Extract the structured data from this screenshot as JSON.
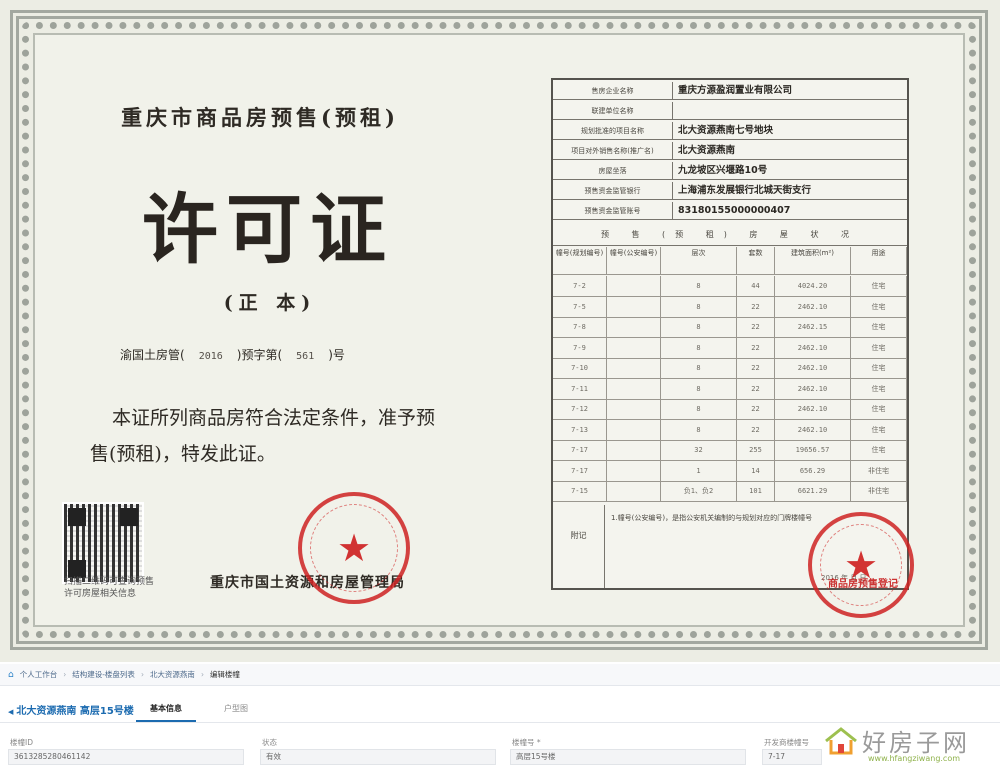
{
  "certificate": {
    "title": "重庆市商品房预售(预租)",
    "big_title": "许可证",
    "copy_type": "(正  本)",
    "number_prefix": "渝国土房管(",
    "year": "2016",
    "number_mid": ")预字第(",
    "serial": "561",
    "number_suffix": ")号",
    "statement": "本证所列商品房符合法定条件，准予预售(预租)，特发此证。",
    "qr_caption": "扫描二维码可查询预售许可房屋相关信息",
    "issuer": "重庆市国土资源和房屋管理局",
    "seal_right_label": "商品房预售登记"
  },
  "info_rows": [
    {
      "label": "售房企业名称",
      "value": "重庆方源盈润置业有限公司"
    },
    {
      "label": "联建单位名称",
      "value": ""
    },
    {
      "label": "规划批准的项目名称",
      "value": "北大资源燕南七号地块"
    },
    {
      "label": "项目对外销售名称(推广名)",
      "value": "北大资源燕南"
    },
    {
      "label": "房屋坐落",
      "value": "九龙坡区兴堰路10号"
    },
    {
      "label": "预售资金监管银行",
      "value": "上海浦东发展银行北城天街支行"
    },
    {
      "label": "预售资金监管账号",
      "value": "83180155000000407"
    }
  ],
  "status_heading": "预 售 (预 租) 房 屋 状 况",
  "grid_headers": [
    "幢号(规划编号)",
    "幢号(公安编号)",
    "层次",
    "套数",
    "建筑面积(m²)",
    "用途"
  ],
  "grid_rows": [
    [
      "7-2",
      "",
      "8",
      "44",
      "4024.20",
      "住宅"
    ],
    [
      "7-5",
      "",
      "8",
      "22",
      "2462.10",
      "住宅"
    ],
    [
      "7-8",
      "",
      "8",
      "22",
      "2462.15",
      "住宅"
    ],
    [
      "7-9",
      "",
      "8",
      "22",
      "2462.10",
      "住宅"
    ],
    [
      "7-10",
      "",
      "8",
      "22",
      "2462.10",
      "住宅"
    ],
    [
      "7-11",
      "",
      "8",
      "22",
      "2462.10",
      "住宅"
    ],
    [
      "7-12",
      "",
      "8",
      "22",
      "2462.10",
      "住宅"
    ],
    [
      "7-13",
      "",
      "8",
      "22",
      "2462.10",
      "住宅"
    ],
    [
      "7-17",
      "",
      "32",
      "255",
      "19656.57",
      "住宅"
    ],
    [
      "7-17",
      "",
      "1",
      "14",
      "656.29",
      "非住宅"
    ],
    [
      "7-15",
      "",
      "负1、负2",
      "101",
      "6621.29",
      "非住宅"
    ]
  ],
  "note": {
    "label": "附记",
    "text": "1.幢号(公安编号)，是指公安机关编制的与规划对应的门牌楼幢号",
    "date": "2016 年  月  日"
  },
  "web": {
    "breadcrumb": [
      "个人工作台",
      "结构建设-楼盘列表",
      "北大资源燕南",
      "编辑楼幢"
    ],
    "building_title": "北大资源燕南 高层15号楼",
    "tabs": [
      "基本信息",
      "户型图"
    ],
    "fields": [
      {
        "label": "楼幢ID",
        "value": "3613285280461142"
      },
      {
        "label": "状态",
        "value": "有效"
      },
      {
        "label": "楼幢号 *",
        "value": "高层15号楼"
      },
      {
        "label": "开发商楼幢号",
        "value": "7-17"
      }
    ]
  },
  "watermark": {
    "text": "好房子网",
    "url": "www.hfangziwang.com"
  },
  "colors": {
    "seal_red": "#ce2222",
    "link_blue": "#1c6bb0"
  }
}
